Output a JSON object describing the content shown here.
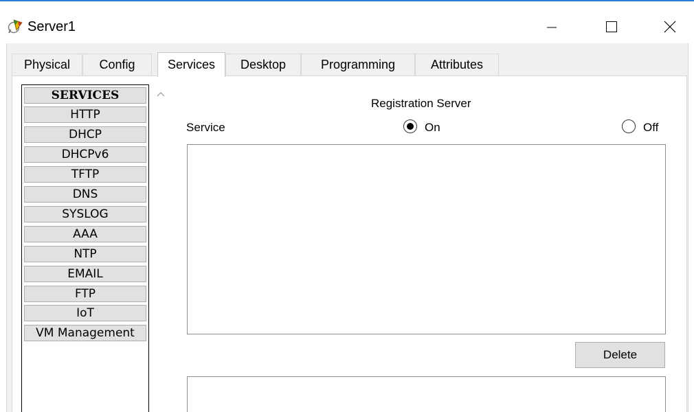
{
  "window": {
    "title": "Server1",
    "minimize_icon": "minimize-icon",
    "maximize_icon": "maximize-icon",
    "close_icon": "close-icon"
  },
  "tabs": [
    {
      "label": "Physical",
      "active": false
    },
    {
      "label": "Config",
      "active": false
    },
    {
      "label": "Services",
      "active": true
    },
    {
      "label": "Desktop",
      "active": false
    },
    {
      "label": "Programming",
      "active": false
    },
    {
      "label": "Attributes",
      "active": false
    }
  ],
  "services": {
    "header": "SERVICES",
    "items": [
      "HTTP",
      "DHCP",
      "DHCPv6",
      "TFTP",
      "DNS",
      "SYSLOG",
      "AAA",
      "NTP",
      "EMAIL",
      "FTP",
      "IoT",
      "VM Management"
    ]
  },
  "panel": {
    "title": "Registration Server",
    "service_label": "Service",
    "on_label": "On",
    "off_label": "Off",
    "selected": "On",
    "delete_label": "Delete"
  },
  "colors": {
    "accent_line": "#2b79d6",
    "window_bg": "#f0f0f0",
    "list_item_bg": "#e1e1e1"
  }
}
